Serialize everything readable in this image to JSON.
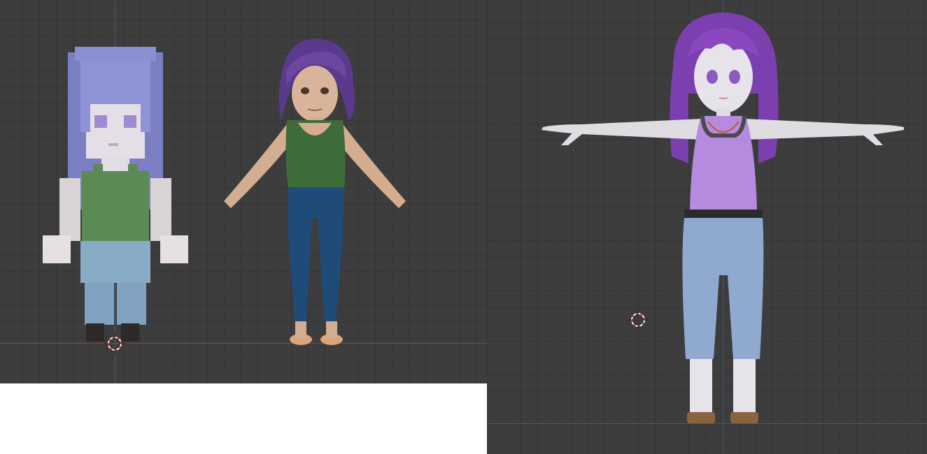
{
  "viewports": [
    {
      "id": "left",
      "models": [
        "pixel-art-character",
        "stylized-character"
      ],
      "axis_color": "#9b3b3b"
    },
    {
      "id": "right",
      "models": [
        "anime-character-t-pose"
      ],
      "axis_color": "#9b3b3b"
    }
  ],
  "colors": {
    "grid_background": "#3d3d3d",
    "grid_line": "#353535",
    "x_axis": "#9b3b3b",
    "z_axis": "#3e5f86"
  }
}
